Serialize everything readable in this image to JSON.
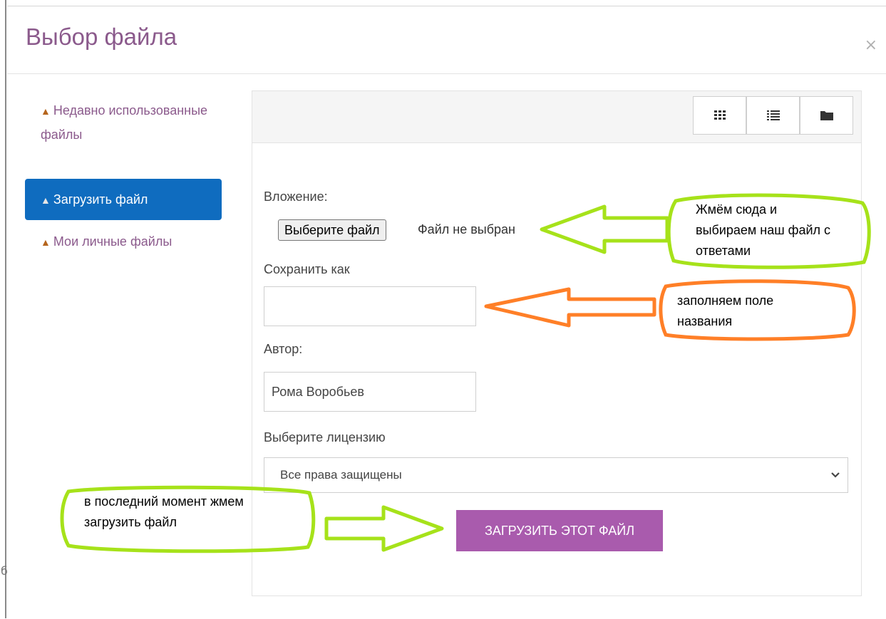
{
  "dialog": {
    "title": "Выбор файла",
    "close": "×",
    "edge_char": "б"
  },
  "sidebar": {
    "items": [
      {
        "label": "Недавно использованные файлы",
        "icon": "repository-icon",
        "active": false
      },
      {
        "label": "Загрузить файл",
        "icon": "upload-icon",
        "active": true
      },
      {
        "label": "Мои личные файлы",
        "icon": "repository-icon",
        "active": false
      }
    ]
  },
  "toolbar": {
    "views": [
      "grid-view-icon",
      "list-view-icon",
      "folder-view-icon"
    ]
  },
  "form": {
    "attachment_label": "Вложение:",
    "choose_button": "Выберите файл",
    "no_file_text": "Файл не выбран",
    "save_as_label": "Сохранить как",
    "save_as_value": "",
    "author_label": "Автор:",
    "author_value": "Рома Воробьев",
    "license_label": "Выберите лицензию",
    "license_value": "Все права защищены",
    "submit_label": "ЗАГРУЗИТЬ ЭТОТ ФАЙЛ"
  },
  "annotations": {
    "choose_file_note": [
      "Жмём сюда и",
      "выбираем наш файл с",
      "ответами"
    ],
    "save_as_note": [
      "заполняем поле",
      "названия"
    ],
    "submit_note": [
      "в последний момент жмем",
      "загрузить файл"
    ]
  },
  "colors": {
    "accent": "#0f6cbf",
    "brand": "#8b5a8c",
    "submit": "#a95bad",
    "annotation_green": "#a6e21a",
    "annotation_orange": "#ff7f27"
  }
}
